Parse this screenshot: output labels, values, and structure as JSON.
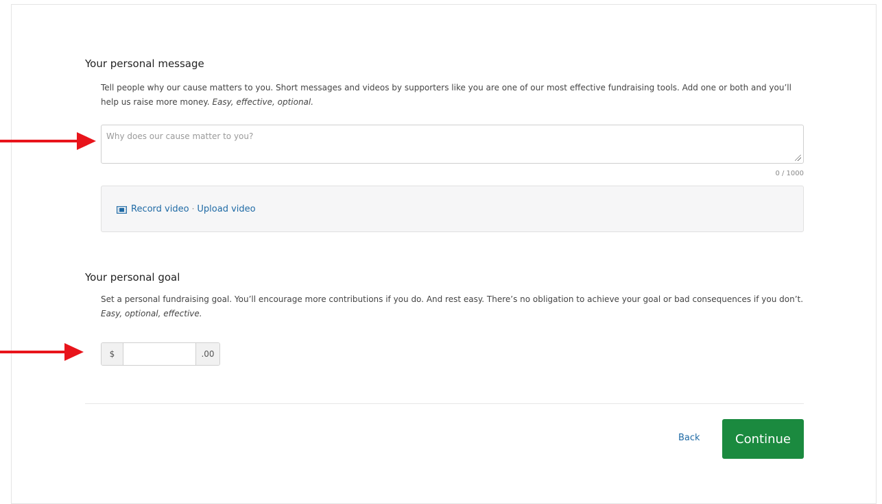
{
  "message_section": {
    "title": "Your personal message",
    "description": "Tell people why our cause matters to you. Short messages and videos by supporters like you are one of our most effective fundraising tools. Add one or both and you’ll help us raise more money.",
    "description_emphasis": "Easy, effective, optional.",
    "textarea_placeholder": "Why does our cause matter to you?",
    "textarea_value": "",
    "char_counter": "0 / 1000",
    "record_video_label": "Record video",
    "separator": "·",
    "upload_video_label": "Upload video"
  },
  "goal_section": {
    "title": "Your personal goal",
    "description": "Set a personal fundraising goal. You’ll encourage more contributions if you do. And rest easy. There’s no obligation to achieve your goal or bad consequences if you don’t.",
    "description_emphasis": "Easy, optional, effective.",
    "currency_prefix": "$",
    "amount_value": "",
    "cents_suffix": ".00"
  },
  "footer": {
    "back_label": "Back",
    "continue_label": "Continue"
  },
  "colors": {
    "accent_green": "#1b8a3f",
    "link_blue": "#1f6aa5",
    "annotation_red": "#e8141b"
  }
}
